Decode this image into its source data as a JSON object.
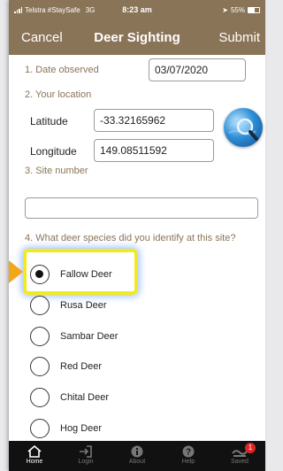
{
  "status_bar": {
    "carrier": "Telstra #StaySafe",
    "network": "3G",
    "time": "8:23 am",
    "battery": "55%",
    "battery_level": 0.55
  },
  "nav": {
    "cancel_label": "Cancel",
    "title": "Deer Sighting",
    "submit_label": "Submit"
  },
  "form": {
    "date_label": "1. Date observed",
    "date_value": "03/07/2020",
    "location_label": "2. Your location",
    "latitude_label": "Latitude",
    "latitude_value": "-33.32165962",
    "longitude_label": "Longitude",
    "longitude_value": "149.08511592",
    "site_label": "3. Site number",
    "site_value": "",
    "species_question": "4. What deer species did you identify at this site?",
    "species_options": [
      {
        "label": "Fallow Deer",
        "selected": true
      },
      {
        "label": "Rusa Deer",
        "selected": false
      },
      {
        "label": "Sambar Deer",
        "selected": false
      },
      {
        "label": "Red Deer",
        "selected": false
      },
      {
        "label": "Chital Deer",
        "selected": false
      },
      {
        "label": "Hog Deer",
        "selected": false
      }
    ]
  },
  "tabs": [
    {
      "label": "Home",
      "icon": "home-icon",
      "active": true
    },
    {
      "label": "Login",
      "icon": "login-icon",
      "active": false
    },
    {
      "label": "About",
      "icon": "info-icon",
      "active": false
    },
    {
      "label": "Help",
      "icon": "help-icon",
      "active": false
    },
    {
      "label": "Saved",
      "icon": "saved-icon",
      "active": false,
      "badge": "1"
    }
  ],
  "colors": {
    "header": "#8a7458",
    "section_label": "#8a7458",
    "highlight": "#f1ea1e",
    "arrow": "#f2a61a",
    "tab_bar": "#111111"
  }
}
